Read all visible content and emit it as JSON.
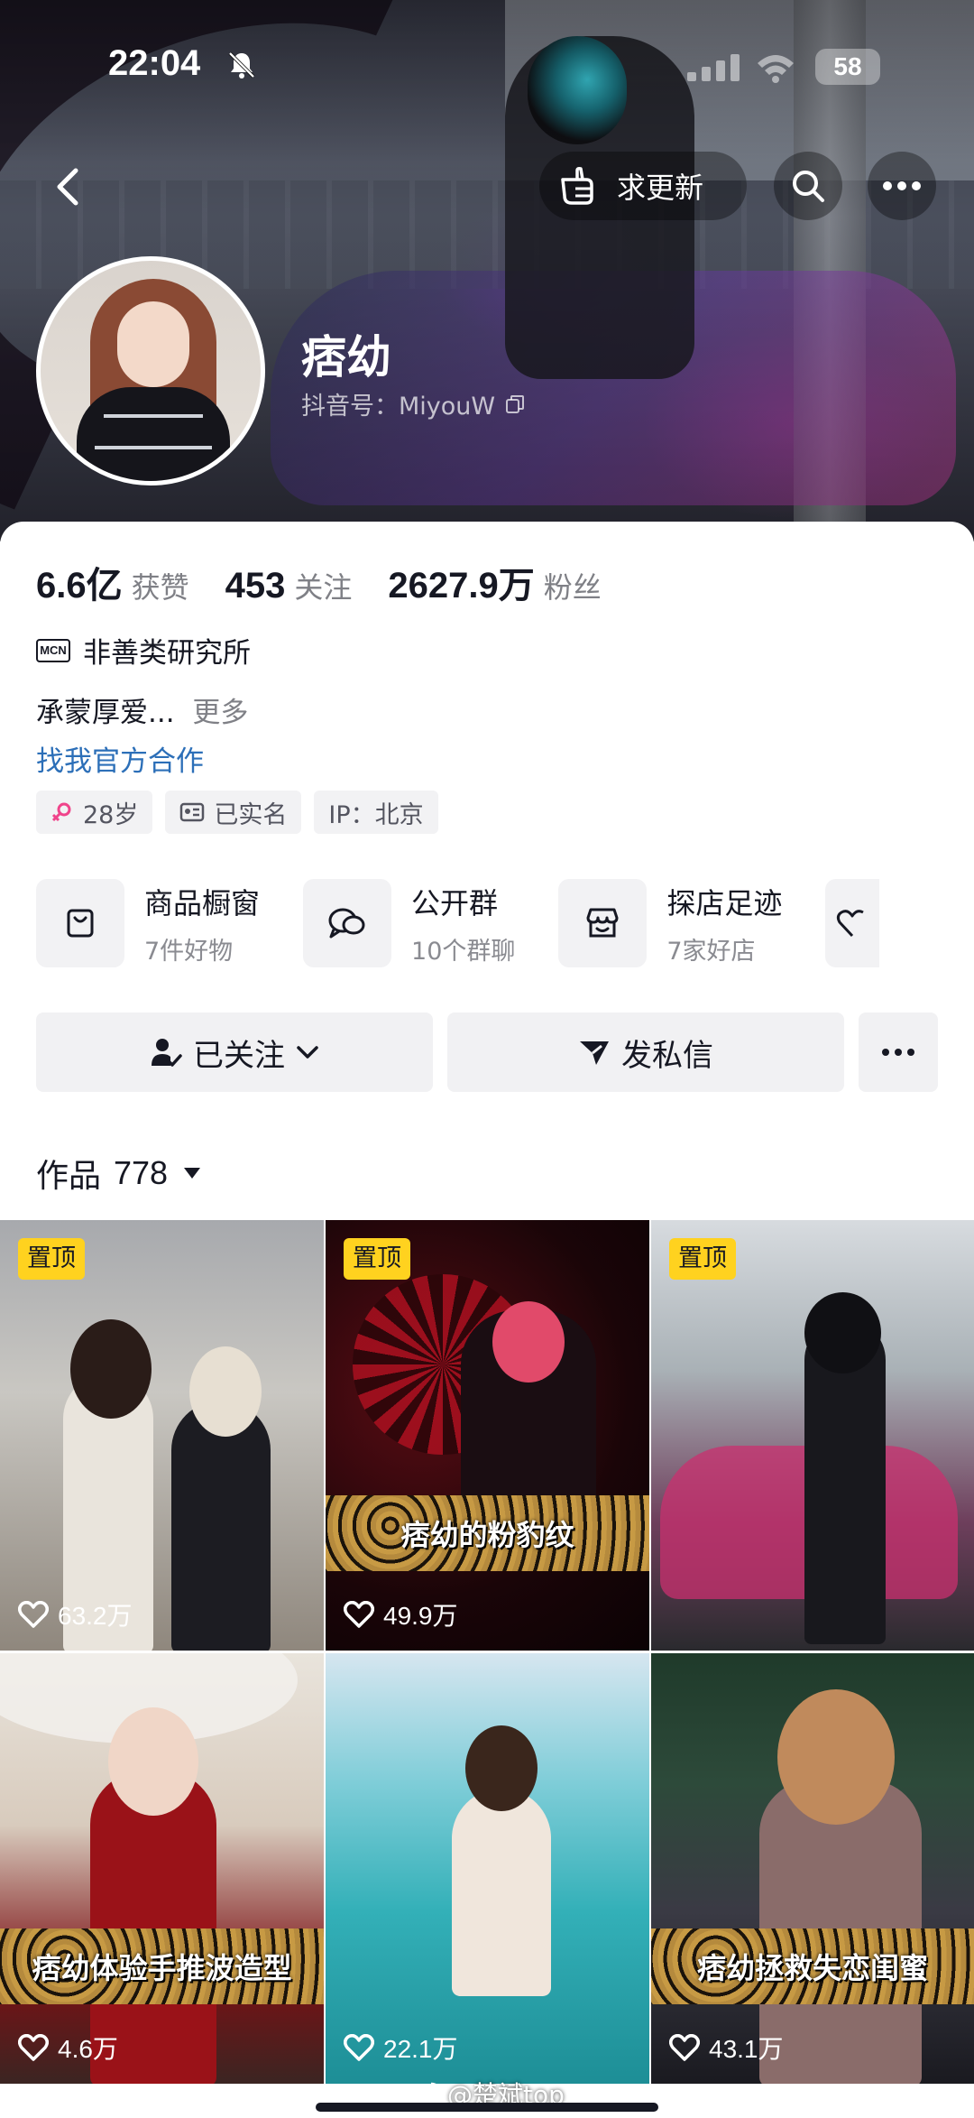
{
  "status_bar": {
    "time": "22:04",
    "battery": "58"
  },
  "header": {
    "update_button": "求更新"
  },
  "profile": {
    "name": "痞幼",
    "douyin_id": "抖音号：MiyouW"
  },
  "stats": [
    {
      "value": "6.6亿",
      "label": "获赞"
    },
    {
      "value": "453",
      "label": "关注"
    },
    {
      "value": "2627.9万",
      "label": "粉丝"
    }
  ],
  "mcn": {
    "badge": "MCN",
    "name": "非善类研究所"
  },
  "bio": {
    "text": "承蒙厚爱...",
    "more": "更多"
  },
  "cooperation_link": "找我官方合作",
  "tags": {
    "age": "28岁",
    "verified": "已实名",
    "ip": "IP：北京"
  },
  "services": [
    {
      "title": "商品橱窗",
      "subtitle": "7件好物",
      "icon": "shopping-bag-icon"
    },
    {
      "title": "公开群",
      "subtitle": "10个群聊",
      "icon": "chat-bubbles-icon"
    },
    {
      "title": "探店足迹",
      "subtitle": "7家好店",
      "icon": "store-icon"
    }
  ],
  "actions": {
    "follow": "已关注",
    "message": "发私信"
  },
  "works": {
    "label": "作品",
    "count": "778"
  },
  "videos": [
    {
      "pinned": "置顶",
      "likes": "63.2万",
      "caption": ""
    },
    {
      "pinned": "置顶",
      "likes": "49.9万",
      "caption": "痞幼的粉豹纹"
    },
    {
      "pinned": "置顶",
      "likes": "",
      "caption": ""
    },
    {
      "pinned": "",
      "likes": "4.6万",
      "caption": "痞幼体验手推波造型"
    },
    {
      "pinned": "",
      "likes": "22.1万",
      "caption": ""
    },
    {
      "pinned": "",
      "likes": "43.1万",
      "caption": "痞幼拯救失恋闺蜜"
    }
  ],
  "watermark": "@楚斌top",
  "colors": {
    "pin_yellow": "#ffd21f",
    "link_blue": "#2c6fb8",
    "text_primary": "#161823",
    "text_secondary": "#7f8086"
  }
}
